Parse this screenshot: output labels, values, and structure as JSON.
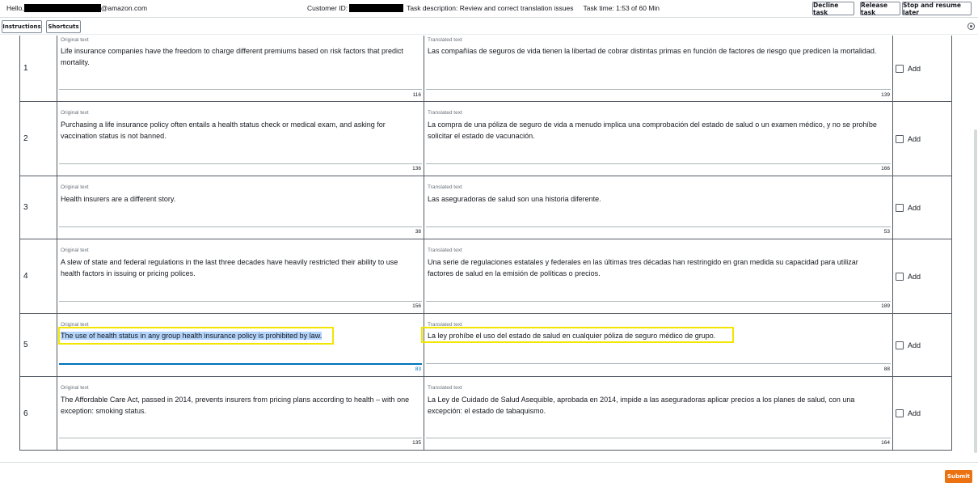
{
  "header": {
    "hello_prefix": "Hello,",
    "email_suffix": "@amazon.com",
    "customer_id_label": "Customer ID:",
    "task_description": "Task description: Review and correct translation issues",
    "task_time": "Task time: 1:53 of 60 Min",
    "decline_label": "Decline task",
    "release_label": "Release task",
    "stop_label": "Stop and resume later"
  },
  "toolbar": {
    "instructions_label": "Instructions",
    "shortcuts_label": "Shortcuts"
  },
  "labels": {
    "original": "Original text",
    "translated": "Translated text",
    "add": "Add"
  },
  "rows": [
    {
      "num": "1",
      "original": "Life insurance companies have the freedom to charge different premiums based on risk factors that predict mortality.",
      "original_count": "116",
      "translated": "Las compañías de seguros de vida tienen la libertad de cobrar distintas primas en función de factores de riesgo que predicen la mortalidad.",
      "translated_count": "139"
    },
    {
      "num": "2",
      "original": "Purchasing a life insurance policy often entails a health status check or medical exam, and asking for vaccination status is not banned.",
      "original_count": "136",
      "translated": "La compra de una póliza de seguro de vida a menudo implica una comprobación del estado de salud o un examen médico, y no se prohíbe solicitar el estado de vacunación.",
      "translated_count": "166"
    },
    {
      "num": "3",
      "original": "Health insurers are a different story.",
      "original_count": "38",
      "translated": "Las aseguradoras de salud son una historia diferente.",
      "translated_count": "53"
    },
    {
      "num": "4",
      "original": "A slew of state and federal regulations in the last three decades have heavily restricted their ability to use health factors in issuing or pricing polices.",
      "original_count": "156",
      "translated": "Una serie de regulaciones estatales y federales en las últimas tres décadas han restringido en gran medida su capacidad para utilizar factores de salud en la emisión de políticas o precios.",
      "translated_count": "189"
    },
    {
      "num": "5",
      "original": "The use of health status in any group health insurance policy is prohibited by law.",
      "original_count": "83",
      "translated": "La ley prohíbe el uso del estado de salud en cualquier póliza de seguro médico de grupo.",
      "translated_count": "88"
    },
    {
      "num": "6",
      "original": "The Affordable Care Act, passed in 2014, prevents insurers from pricing plans according to health – with one exception: smoking status.",
      "original_count": "135",
      "translated": "La Ley de Cuidado de Salud Asequible, aprobada en 2014, impide a las aseguradoras aplicar precios a los planes de salud, con una excepción: el estado de tabaquismo.",
      "translated_count": "164"
    }
  ],
  "footer": {
    "submit_label": "Submit"
  },
  "colors": {
    "accent": "#ec7211",
    "highlight": "#f2e600",
    "focus": "#0073bb"
  }
}
